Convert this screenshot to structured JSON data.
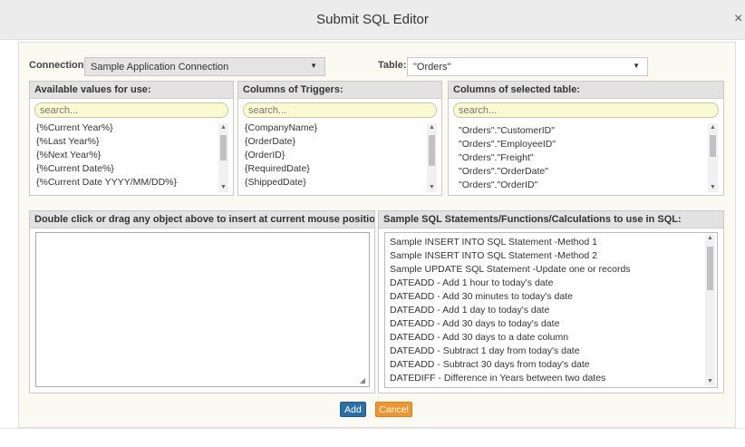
{
  "window": {
    "title": "Submit SQL Editor",
    "close_glyph": "×"
  },
  "connection": {
    "label": "Connection:",
    "value": "Sample Application Connection"
  },
  "table": {
    "label": "Table:",
    "value": "\"Orders\""
  },
  "available_values": {
    "header": "Available values for use:",
    "search_placeholder": "search...",
    "items": [
      "{%Current Year%}",
      "{%Last Year%}",
      "{%Next Year%}",
      "{%Current Date%}",
      "{%Current Date YYYY/MM/DD%}"
    ]
  },
  "trigger_columns": {
    "header": "Columns of Triggers:",
    "search_placeholder": "search...",
    "items": [
      "{CompanyName}",
      "{OrderDate}",
      "{OrderID}",
      "{RequiredDate}",
      "{ShippedDate}"
    ]
  },
  "table_columns": {
    "header": "Columns of selected table:",
    "search_placeholder": "search...",
    "items": [
      "\"Orders\".\"CustomerID\"",
      "\"Orders\".\"EmployeeID\"",
      "\"Orders\".\"Freight\"",
      "\"Orders\".\"OrderDate\"",
      "\"Orders\".\"OrderID\""
    ]
  },
  "editor": {
    "header": "Double click or drag any object above to insert at current mouse position."
  },
  "samples": {
    "header": "Sample SQL Statements/Functions/Calculations to use in SQL:",
    "items": [
      "Sample INSERT INTO SQL Statement -Method 1",
      "Sample INSERT INTO SQL Statement -Method 2",
      "Sample UPDATE SQL Statement -Update one or records",
      "DATEADD - Add 1 hour to today's date",
      "DATEADD - Add 30 minutes to today's date",
      "DATEADD - Add 1 day to today's date",
      "DATEADD - Add 30 days to today's date",
      "DATEADD - Add 30 days to a date column",
      "DATEADD - Subtract 1 day from today's date",
      "DATEADD - Subtract 30 days from today's date",
      "DATEDIFF - Difference in Years between two dates"
    ]
  },
  "buttons": {
    "add": "Add",
    "cancel": "Cancel"
  },
  "colors": {
    "add_button": "#2a6fa8",
    "cancel_button": "#f0952d",
    "search_bg": "#fafad2"
  }
}
